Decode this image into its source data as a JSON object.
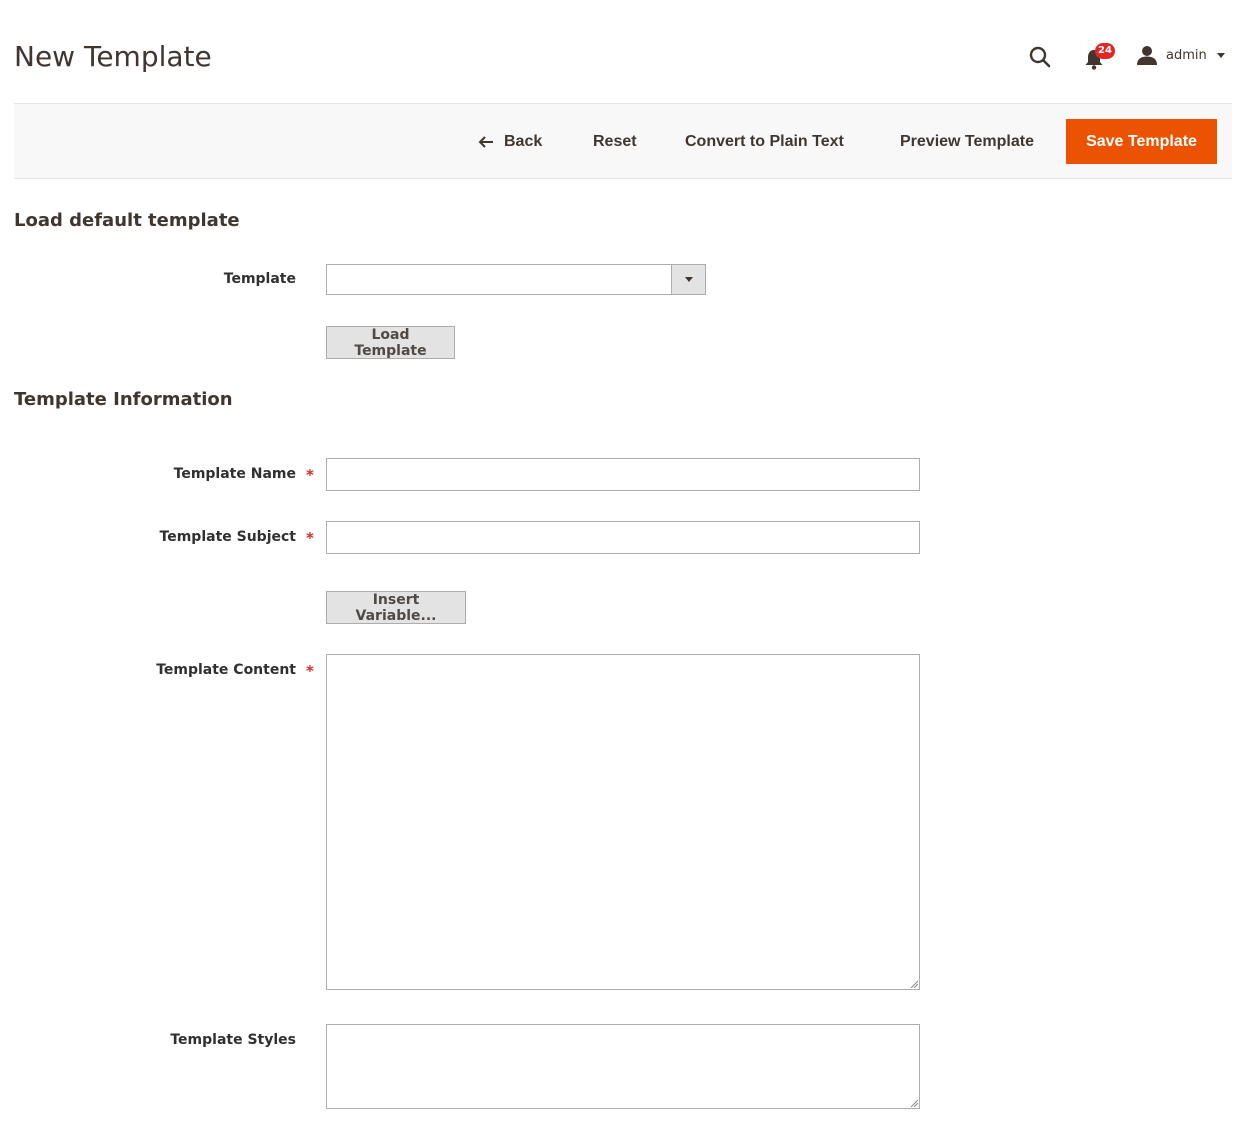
{
  "header": {
    "title": "New Template",
    "notifications_count": "24",
    "user_name": "admin"
  },
  "toolbar": {
    "back_label": "Back",
    "reset_label": "Reset",
    "convert_label": "Convert to Plain Text",
    "preview_label": "Preview Template",
    "save_label": "Save Template"
  },
  "load_section": {
    "title": "Load default template",
    "template_label": "Template",
    "template_value": "",
    "load_button": "Load Template"
  },
  "info_section": {
    "title": "Template Information",
    "name_label": "Template Name",
    "name_value": "",
    "subject_label": "Template Subject",
    "subject_value": "",
    "insert_variable_button": "Insert Variable...",
    "content_label": "Template Content",
    "content_value": "",
    "styles_label": "Template Styles",
    "styles_value": "",
    "required_mark": "*"
  },
  "colors": {
    "accent": "#eb5202",
    "badge": "#e22626",
    "text": "#41362f",
    "toolbar_bg": "#f8f8f8"
  },
  "icons": {
    "search": "search-icon",
    "notifications": "bell-icon",
    "user": "user-icon",
    "back": "arrow-left-icon"
  }
}
